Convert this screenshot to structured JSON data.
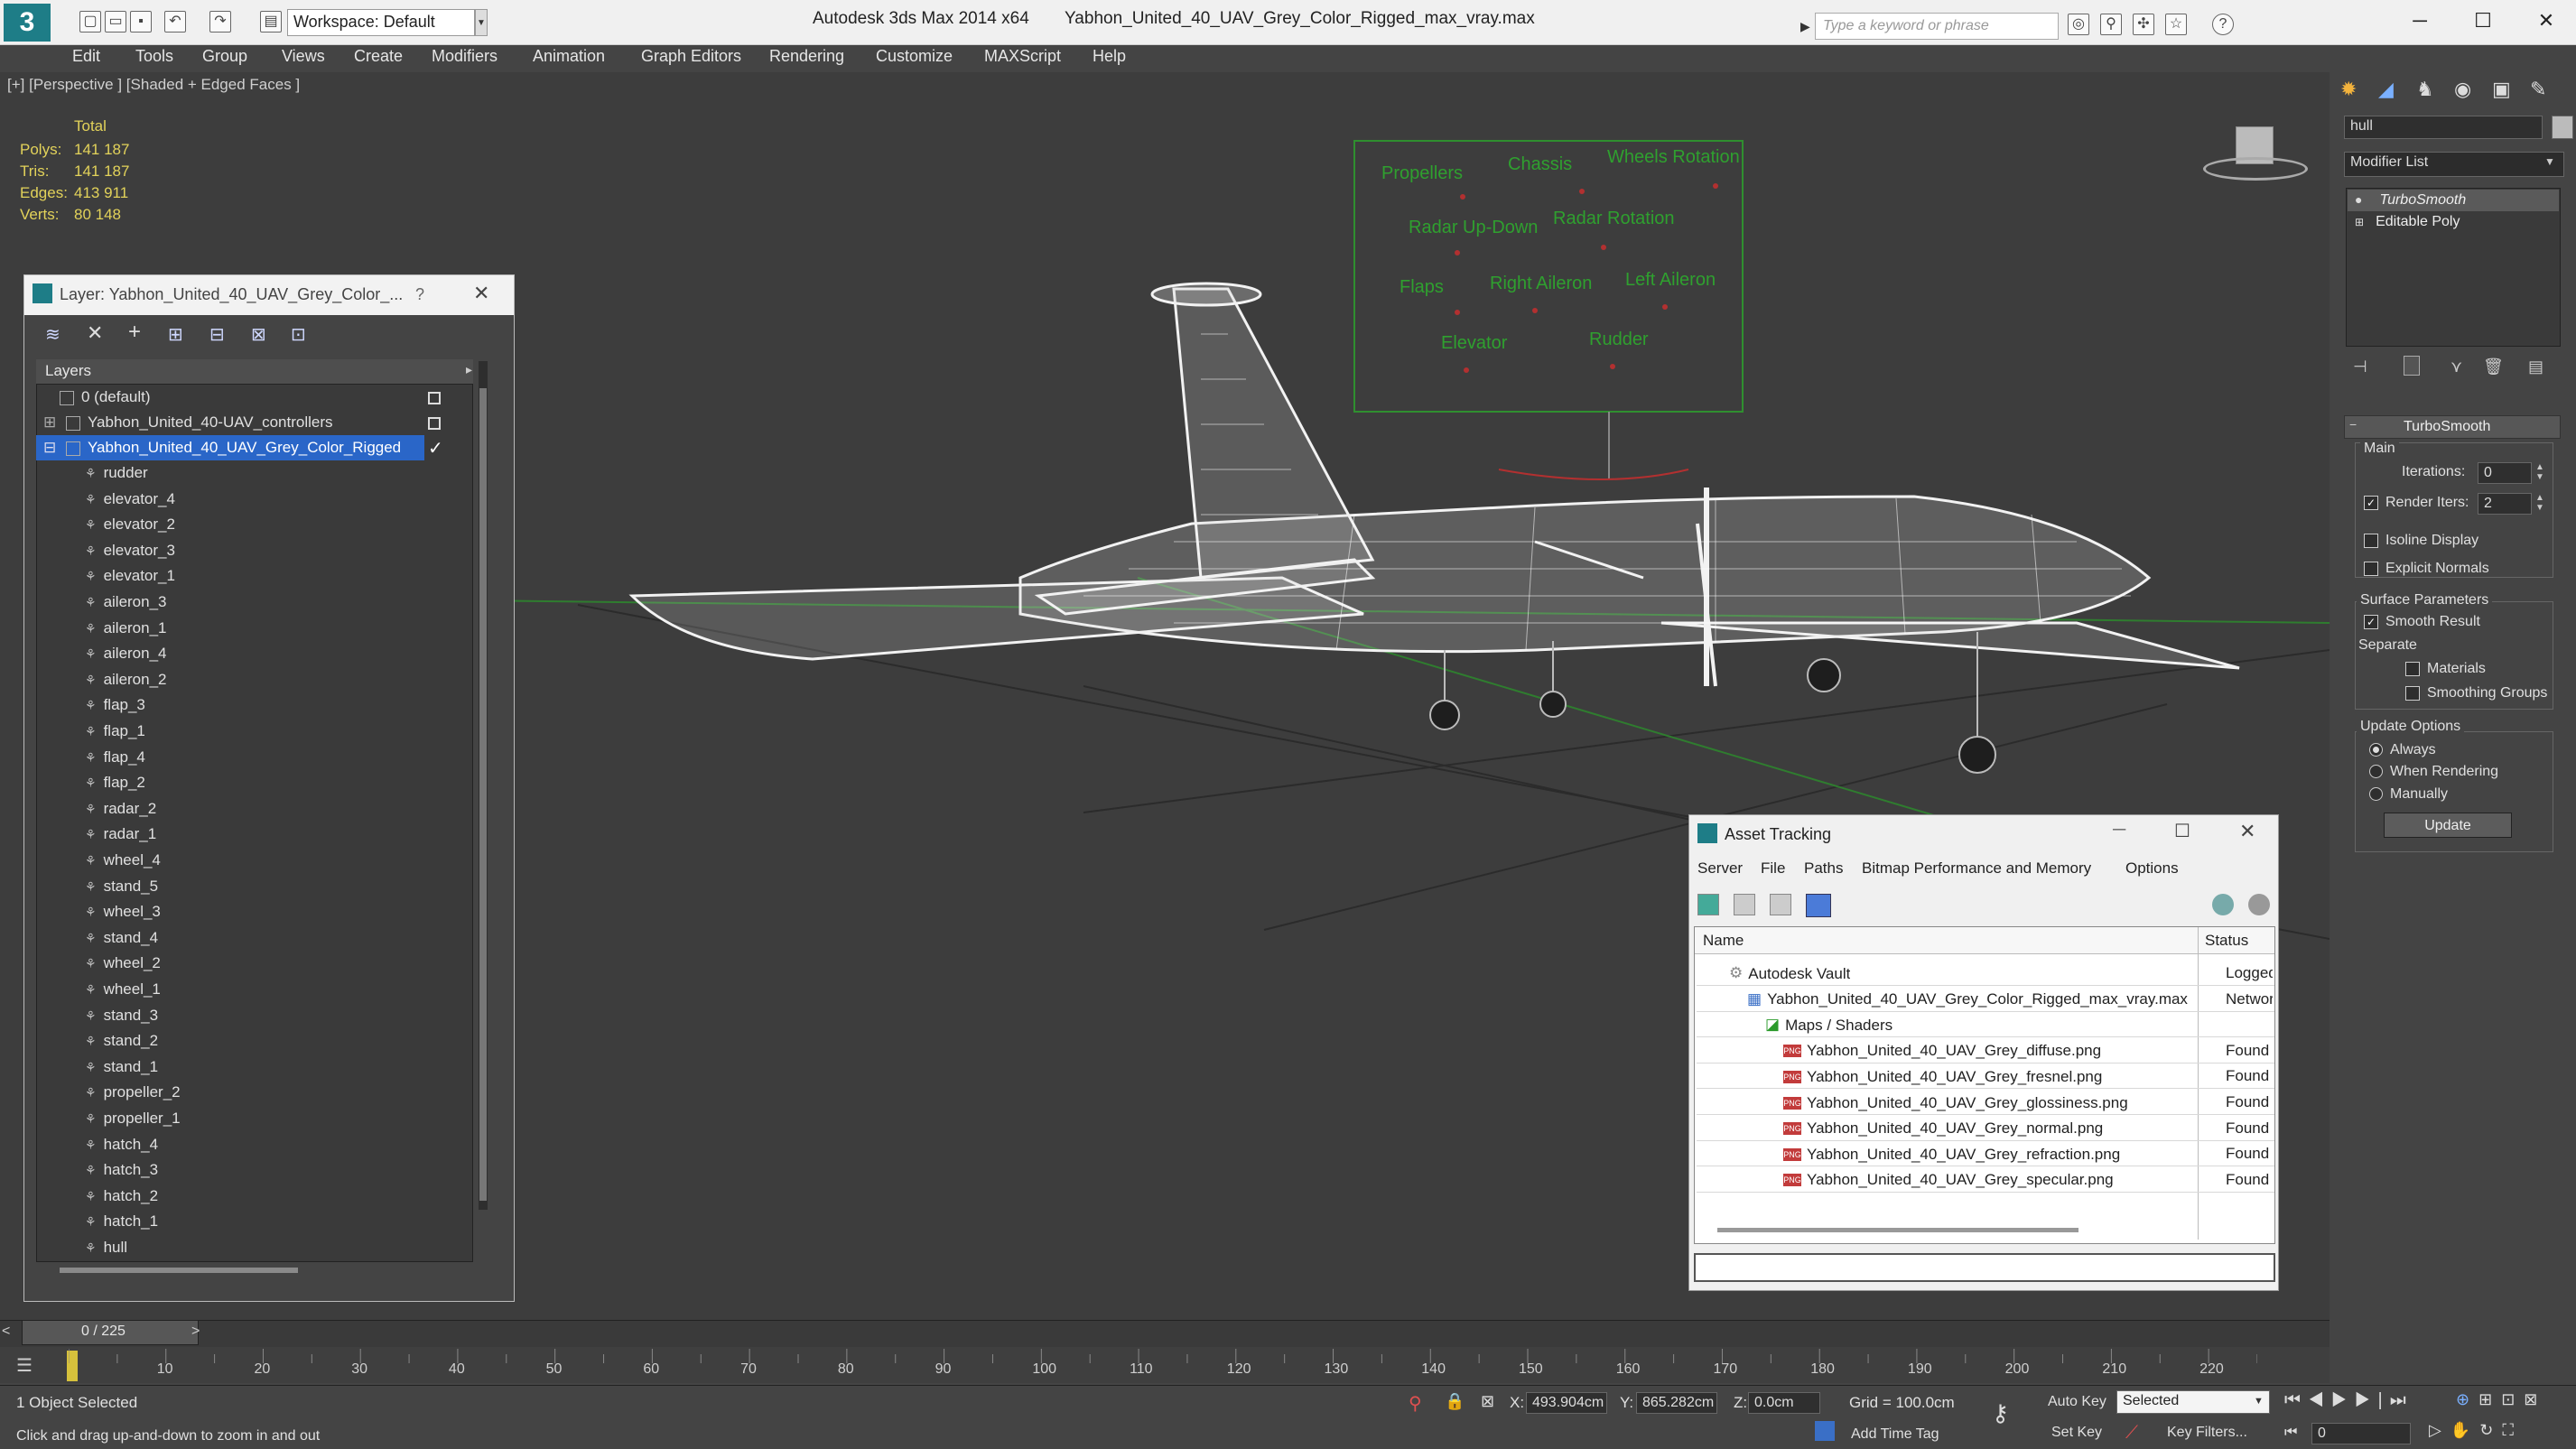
{
  "titlebar": {
    "workspace_value": "Workspace: Default",
    "app_name": "Autodesk 3ds Max  2014 x64",
    "file_name": "Yabhon_United_40_UAV_Grey_Color_Rigged_max_vray.max",
    "search_placeholder": "Type a keyword or phrase"
  },
  "menu": [
    "Edit",
    "Tools",
    "Group",
    "Views",
    "Create",
    "Modifiers",
    "Animation",
    "Graph Editors",
    "Rendering",
    "Customize",
    "MAXScript",
    "Help"
  ],
  "viewport": {
    "label": "[+] [Perspective ] [Shaded + Edged Faces ]",
    "stats": {
      "header": "Total",
      "polys_label": "Polys:",
      "polys": "141 187",
      "tris_label": "Tris:",
      "tris": "141 187",
      "edges_label": "Edges:",
      "edges": "413 911",
      "verts_label": "Verts:",
      "verts": "80 148"
    },
    "controls": [
      "Propellers",
      "Chassis",
      "Wheels Rotation",
      "Radar Up-Down",
      "Radar Rotation",
      "Flaps",
      "Right Aileron",
      "Left Aileron",
      "Elevator",
      "Rudder"
    ]
  },
  "layer_panel": {
    "title": "Layer: Yabhon_United_40_UAV_Grey_Color_...",
    "help": "?",
    "header": "Layers",
    "layers": [
      "0 (default)",
      "Yabhon_United_40-UAV_controllers",
      "Yabhon_United_40_UAV_Grey_Color_Rigged"
    ],
    "objects": [
      "rudder",
      "elevator_4",
      "elevator_2",
      "elevator_3",
      "elevator_1",
      "aileron_3",
      "aileron_1",
      "aileron_4",
      "aileron_2",
      "flap_3",
      "flap_1",
      "flap_4",
      "flap_2",
      "radar_2",
      "radar_1",
      "wheel_4",
      "stand_5",
      "wheel_3",
      "stand_4",
      "wheel_2",
      "wheel_1",
      "stand_3",
      "stand_2",
      "stand_1",
      "propeller_2",
      "propeller_1",
      "hatch_4",
      "hatch_3",
      "hatch_2",
      "hatch_1",
      "hull"
    ]
  },
  "asset_tracking": {
    "title": "Asset Tracking",
    "menu": [
      "Server",
      "File",
      "Paths",
      "Bitmap Performance and Memory",
      "Options"
    ],
    "col_name": "Name",
    "col_status": "Status",
    "rows": [
      {
        "name": "Autodesk Vault",
        "status": "Logged O"
      },
      {
        "name": "Yabhon_United_40_UAV_Grey_Color_Rigged_max_vray.max",
        "status": "Network P"
      },
      {
        "name": "Maps / Shaders",
        "status": ""
      },
      {
        "name": "Yabhon_United_40_UAV_Grey_diffuse.png",
        "status": "Found"
      },
      {
        "name": "Yabhon_United_40_UAV_Grey_fresnel.png",
        "status": "Found"
      },
      {
        "name": "Yabhon_United_40_UAV_Grey_glossiness.png",
        "status": "Found"
      },
      {
        "name": "Yabhon_United_40_UAV_Grey_normal.png",
        "status": "Found"
      },
      {
        "name": "Yabhon_United_40_UAV_Grey_refraction.png",
        "status": "Found"
      },
      {
        "name": "Yabhon_United_40_UAV_Grey_specular.png",
        "status": "Found"
      }
    ]
  },
  "command_panel": {
    "name_field": "hull",
    "modifier_list": "Modifier List",
    "stack": [
      "TurboSmooth",
      "Editable Poly"
    ],
    "rollout_title": "TurboSmooth",
    "main": "Main",
    "iterations_label": "Iterations:",
    "iterations": "0",
    "render_iters_label": "Render Iters:",
    "render_iters": "2",
    "isoline": "Isoline Display",
    "explicit_normals": "Explicit Normals",
    "surface_params": "Surface Parameters",
    "smooth_result": "Smooth Result",
    "separate": "Separate",
    "materials": "Materials",
    "smoothing_groups": "Smoothing Groups",
    "update_options": "Update Options",
    "always": "Always",
    "when_rendering": "When Rendering",
    "manually": "Manually",
    "update_button": "Update"
  },
  "timeline": {
    "frame_counter": "0 / 225",
    "ticks": [
      "10",
      "20",
      "30",
      "40",
      "50",
      "60",
      "70",
      "80",
      "90",
      "100",
      "110",
      "120",
      "130",
      "140",
      "150",
      "160",
      "170",
      "180",
      "190",
      "200",
      "210",
      "220"
    ]
  },
  "status": {
    "selection": "1 Object Selected",
    "prompt": "Click and drag up-and-down to zoom in and out",
    "x_label": "X:",
    "x": "493.904cm",
    "y_label": "Y:",
    "y": "865.282cm",
    "z_label": "Z:",
    "z": "0.0cm",
    "grid": "Grid = 100.0cm",
    "auto_key": "Auto Key",
    "set_key": "Set Key",
    "selected": "Selected",
    "key_filters": "Key Filters...",
    "add_time_tag": "Add Time Tag",
    "frame": "0"
  }
}
